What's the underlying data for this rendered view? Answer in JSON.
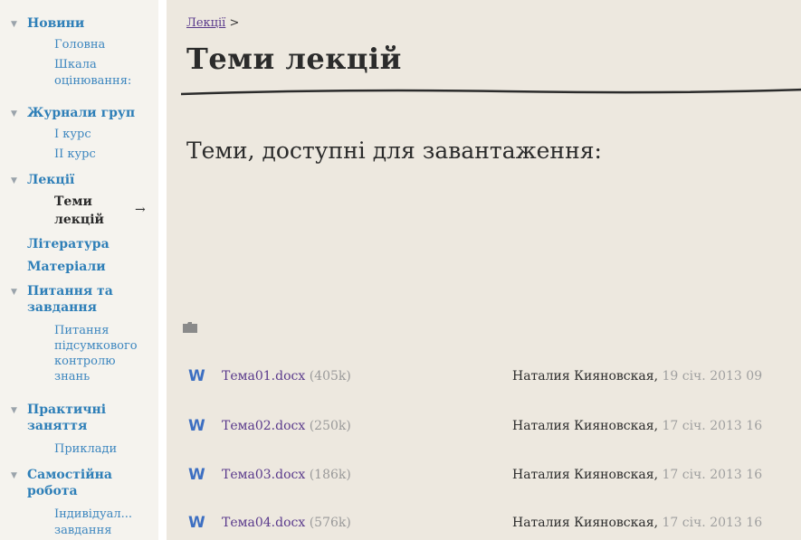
{
  "sidebar": {
    "news": {
      "label": "Новини",
      "items": [
        "Головна",
        "Шкала",
        "оцінювання:"
      ]
    },
    "journals": {
      "label": "Журнали груп",
      "items": [
        "I курс",
        "II курс"
      ]
    },
    "lectures": {
      "label": "Лекції",
      "current": [
        "Теми",
        "лекцій"
      ],
      "current_marker": "→"
    },
    "literature": "Література",
    "materials": "Матеріали",
    "questions": {
      "label": [
        "Питання та",
        "завдання"
      ],
      "items": [
        "Питання",
        "підсумкового",
        "контролю",
        "знань"
      ]
    },
    "practice": {
      "label": [
        "Практичні",
        "заняття"
      ],
      "items": [
        "Приклади"
      ]
    },
    "selfwork": {
      "label": [
        "Самостійна",
        "робота"
      ],
      "items": [
        "Індивідуал...",
        "завдання"
      ]
    }
  },
  "main": {
    "breadcrumb": {
      "link": "Лекції",
      "separator": ">"
    },
    "title": "Теми лекцій",
    "section_title": "Теми, доступні для завантаження:",
    "files": [
      {
        "icon": "W",
        "name": "Тема01.docx",
        "size": "(405k)",
        "author": "Наталия Кияновская,",
        "date": "19 січ. 2013 09"
      },
      {
        "icon": "W",
        "name": "Тема02.docx",
        "size": "(250k)",
        "author": "Наталия Кияновская,",
        "date": "17 січ. 2013 16"
      },
      {
        "icon": "W",
        "name": "Тема03.docx",
        "size": "(186k)",
        "author": "Наталия Кияновская,",
        "date": "17 січ. 2013 16"
      },
      {
        "icon": "W",
        "name": "Тема04.docx",
        "size": "(576k)",
        "author": "Наталия Кияновская,",
        "date": "17 січ. 2013 16"
      }
    ]
  },
  "colors": {
    "link": "#2e7fb8",
    "visited": "#5a3a8c",
    "content_bg": "#ede8df",
    "word_icon": "#3d6fc2"
  }
}
